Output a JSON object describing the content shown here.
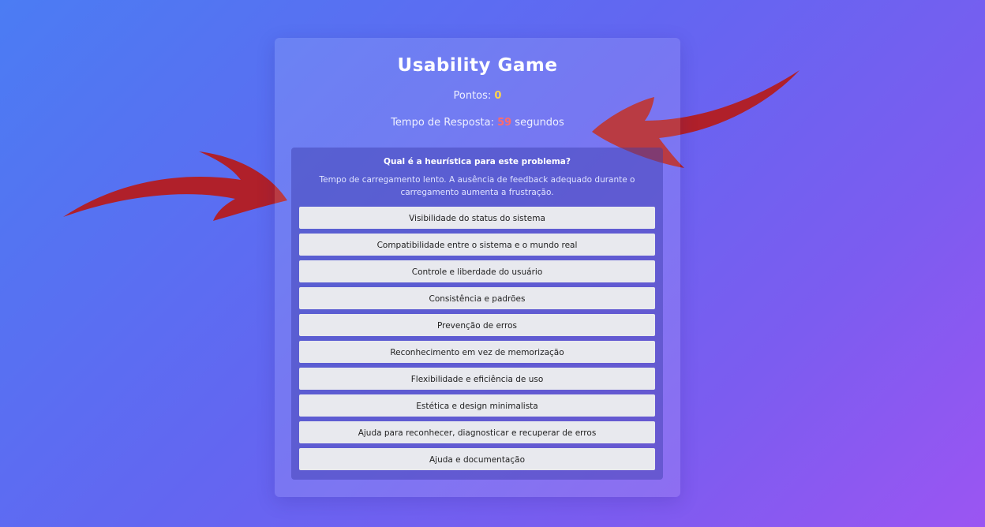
{
  "game": {
    "title": "Usability Game",
    "score_label": "Pontos: ",
    "score_value": "0",
    "timer_label": "Tempo de Resposta: ",
    "timer_value": "59",
    "timer_unit": " segundos"
  },
  "question": {
    "prompt": "Qual é a heurística para este problema?",
    "description": "Tempo de carregamento lento. A ausência de feedback adequado durante o carregamento aumenta a frustração."
  },
  "options": [
    "Visibilidade do status do sistema",
    "Compatibilidade entre o sistema e o mundo real",
    "Controle e liberdade do usuário",
    "Consistência e padrões",
    "Prevenção de erros",
    "Reconhecimento em vez de memorização",
    "Flexibilidade e eficiência de uso",
    "Estética e design minimalista",
    "Ajuda para reconhecer, diagnosticar e recuperar de erros",
    "Ajuda e documentação"
  ],
  "colors": {
    "score": "#ffd54a",
    "timer": "#ff6b6b",
    "arrow": "#b0202a"
  }
}
